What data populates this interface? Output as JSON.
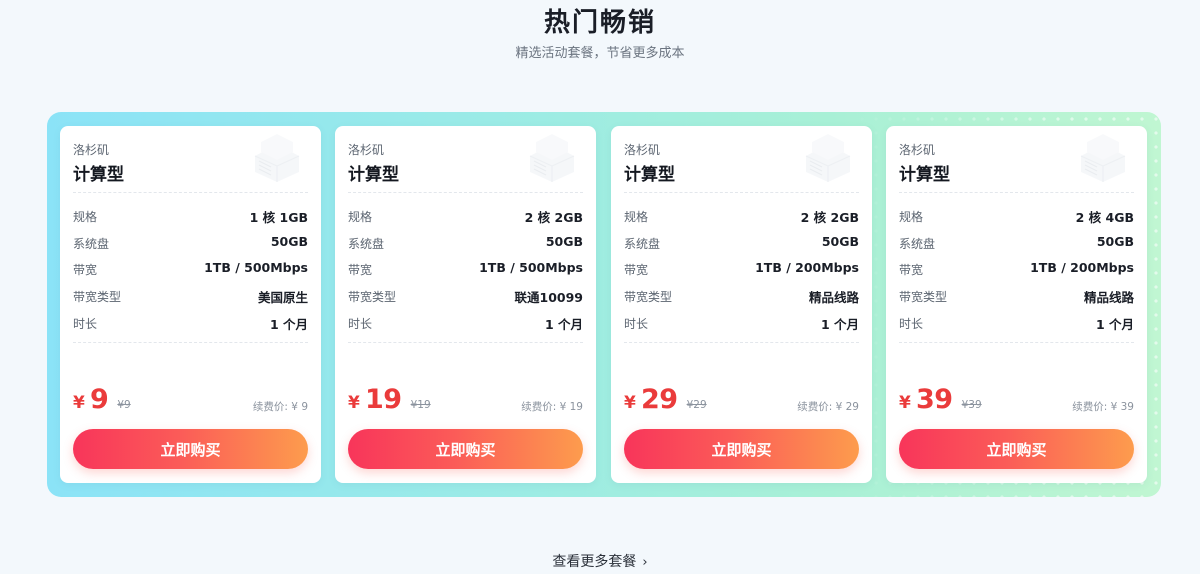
{
  "header": {
    "title": "热门畅销",
    "subtitle": "精选活动套餐，节省更多成本"
  },
  "labels": {
    "spec": "规格",
    "disk": "系统盘",
    "bandwidth": "带宽",
    "bandwidth_type": "带宽类型",
    "duration": "时长",
    "currency": "¥",
    "buy_button": "立即购买"
  },
  "cards": [
    {
      "location": "洛杉矶",
      "type": "计算型",
      "spec": "1 核 1GB",
      "disk": "50GB",
      "bandwidth": "1TB / 500Mbps",
      "bandwidth_type": "美国原生",
      "duration": "1 个月",
      "price": "9",
      "old_price": "¥9",
      "renew": "续费价: ¥ 9"
    },
    {
      "location": "洛杉矶",
      "type": "计算型",
      "spec": "2 核 2GB",
      "disk": "50GB",
      "bandwidth": "1TB / 500Mbps",
      "bandwidth_type": "联通10099",
      "duration": "1 个月",
      "price": "19",
      "old_price": "¥19",
      "renew": "续费价: ¥ 19"
    },
    {
      "location": "洛杉矶",
      "type": "计算型",
      "spec": "2 核 2GB",
      "disk": "50GB",
      "bandwidth": "1TB / 200Mbps",
      "bandwidth_type": "精品线路",
      "duration": "1 个月",
      "price": "29",
      "old_price": "¥29",
      "renew": "续费价: ¥ 29"
    },
    {
      "location": "洛杉矶",
      "type": "计算型",
      "spec": "2 核 4GB",
      "disk": "50GB",
      "bandwidth": "1TB / 200Mbps",
      "bandwidth_type": "精品线路",
      "duration": "1 个月",
      "price": "39",
      "old_price": "¥39",
      "renew": "续费价: ¥ 39"
    }
  ],
  "footer": {
    "more_link": "查看更多套餐",
    "more_icon": "chevron-right-icon"
  },
  "colors": {
    "price_red": "#ea3b3b",
    "button_gradient_start": "#f8355a",
    "button_gradient_end": "#fd9c4d",
    "panel_gradient_start": "#8be3f7",
    "panel_gradient_end": "#c0f6d2"
  }
}
